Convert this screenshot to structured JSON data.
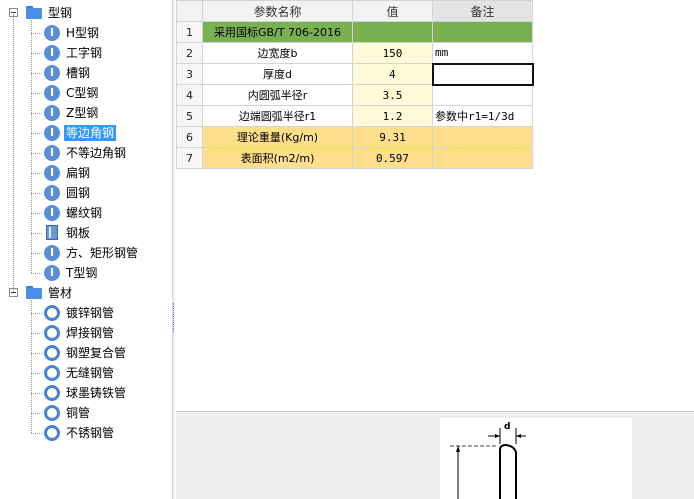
{
  "tree": {
    "groups": [
      {
        "label": "型钢",
        "items": [
          {
            "label": "H型钢",
            "icon": "i-beam-icon"
          },
          {
            "label": "工字钢",
            "icon": "i-beam-icon"
          },
          {
            "label": "槽钢",
            "icon": "i-beam-icon"
          },
          {
            "label": "C型钢",
            "icon": "i-beam-icon"
          },
          {
            "label": "Z型钢",
            "icon": "i-beam-icon"
          },
          {
            "label": "等边角钢",
            "icon": "i-beam-icon",
            "selected": true
          },
          {
            "label": "不等边角钢",
            "icon": "i-beam-icon"
          },
          {
            "label": "扁钢",
            "icon": "i-beam-icon"
          },
          {
            "label": "圆钢",
            "icon": "i-beam-icon"
          },
          {
            "label": "螺纹钢",
            "icon": "i-beam-icon"
          },
          {
            "label": "钢板",
            "icon": "steel-plate-icon"
          },
          {
            "label": "方、矩形钢管",
            "icon": "i-beam-icon"
          },
          {
            "label": "T型钢",
            "icon": "i-beam-icon"
          }
        ]
      },
      {
        "label": "管材",
        "items": [
          {
            "label": "镀锌钢管",
            "icon": "pipe-ring-icon"
          },
          {
            "label": "焊接钢管",
            "icon": "pipe-ring-icon"
          },
          {
            "label": "钢塑复合管",
            "icon": "pipe-ring-icon"
          },
          {
            "label": "无缝钢管",
            "icon": "pipe-ring-icon"
          },
          {
            "label": "球墨铸铁管",
            "icon": "pipe-ring-icon"
          },
          {
            "label": "铜管",
            "icon": "pipe-ring-icon"
          },
          {
            "label": "不锈钢管",
            "icon": "pipe-ring-icon"
          }
        ]
      }
    ]
  },
  "grid": {
    "columns": {
      "name": "参数名称",
      "value": "值",
      "remark": "备注"
    },
    "rows": [
      {
        "num": "1",
        "name": "采用国标GB/T 706-2016",
        "value": "",
        "remark": "",
        "style": "green"
      },
      {
        "num": "2",
        "name": "边宽度b",
        "value": "150",
        "remark": "mm",
        "style": "input"
      },
      {
        "num": "3",
        "name": "厚度d",
        "value": "4",
        "remark": "",
        "style": "input",
        "active": true
      },
      {
        "num": "4",
        "name": "内圆弧半径r",
        "value": "3.5",
        "remark": "",
        "style": "input"
      },
      {
        "num": "5",
        "name": "边端圆弧半径r1",
        "value": "1.2",
        "remark": "参数中r1=1/3d",
        "style": "input"
      },
      {
        "num": "6",
        "name": "理论重量(Kg/m)",
        "value": "9.31",
        "remark": "",
        "style": "orange"
      },
      {
        "num": "7",
        "name": "表面积(m2/m)",
        "value": "0.597",
        "remark": "",
        "style": "orange"
      }
    ]
  },
  "preview": {
    "dimension_label": "d"
  },
  "colors": {
    "selection": "#3399ff",
    "header_green": "#78b052",
    "result_orange": "#ffdf8c",
    "input_yellow": "#fffbd9",
    "tree_icon_blue": "#5b8dd8"
  }
}
